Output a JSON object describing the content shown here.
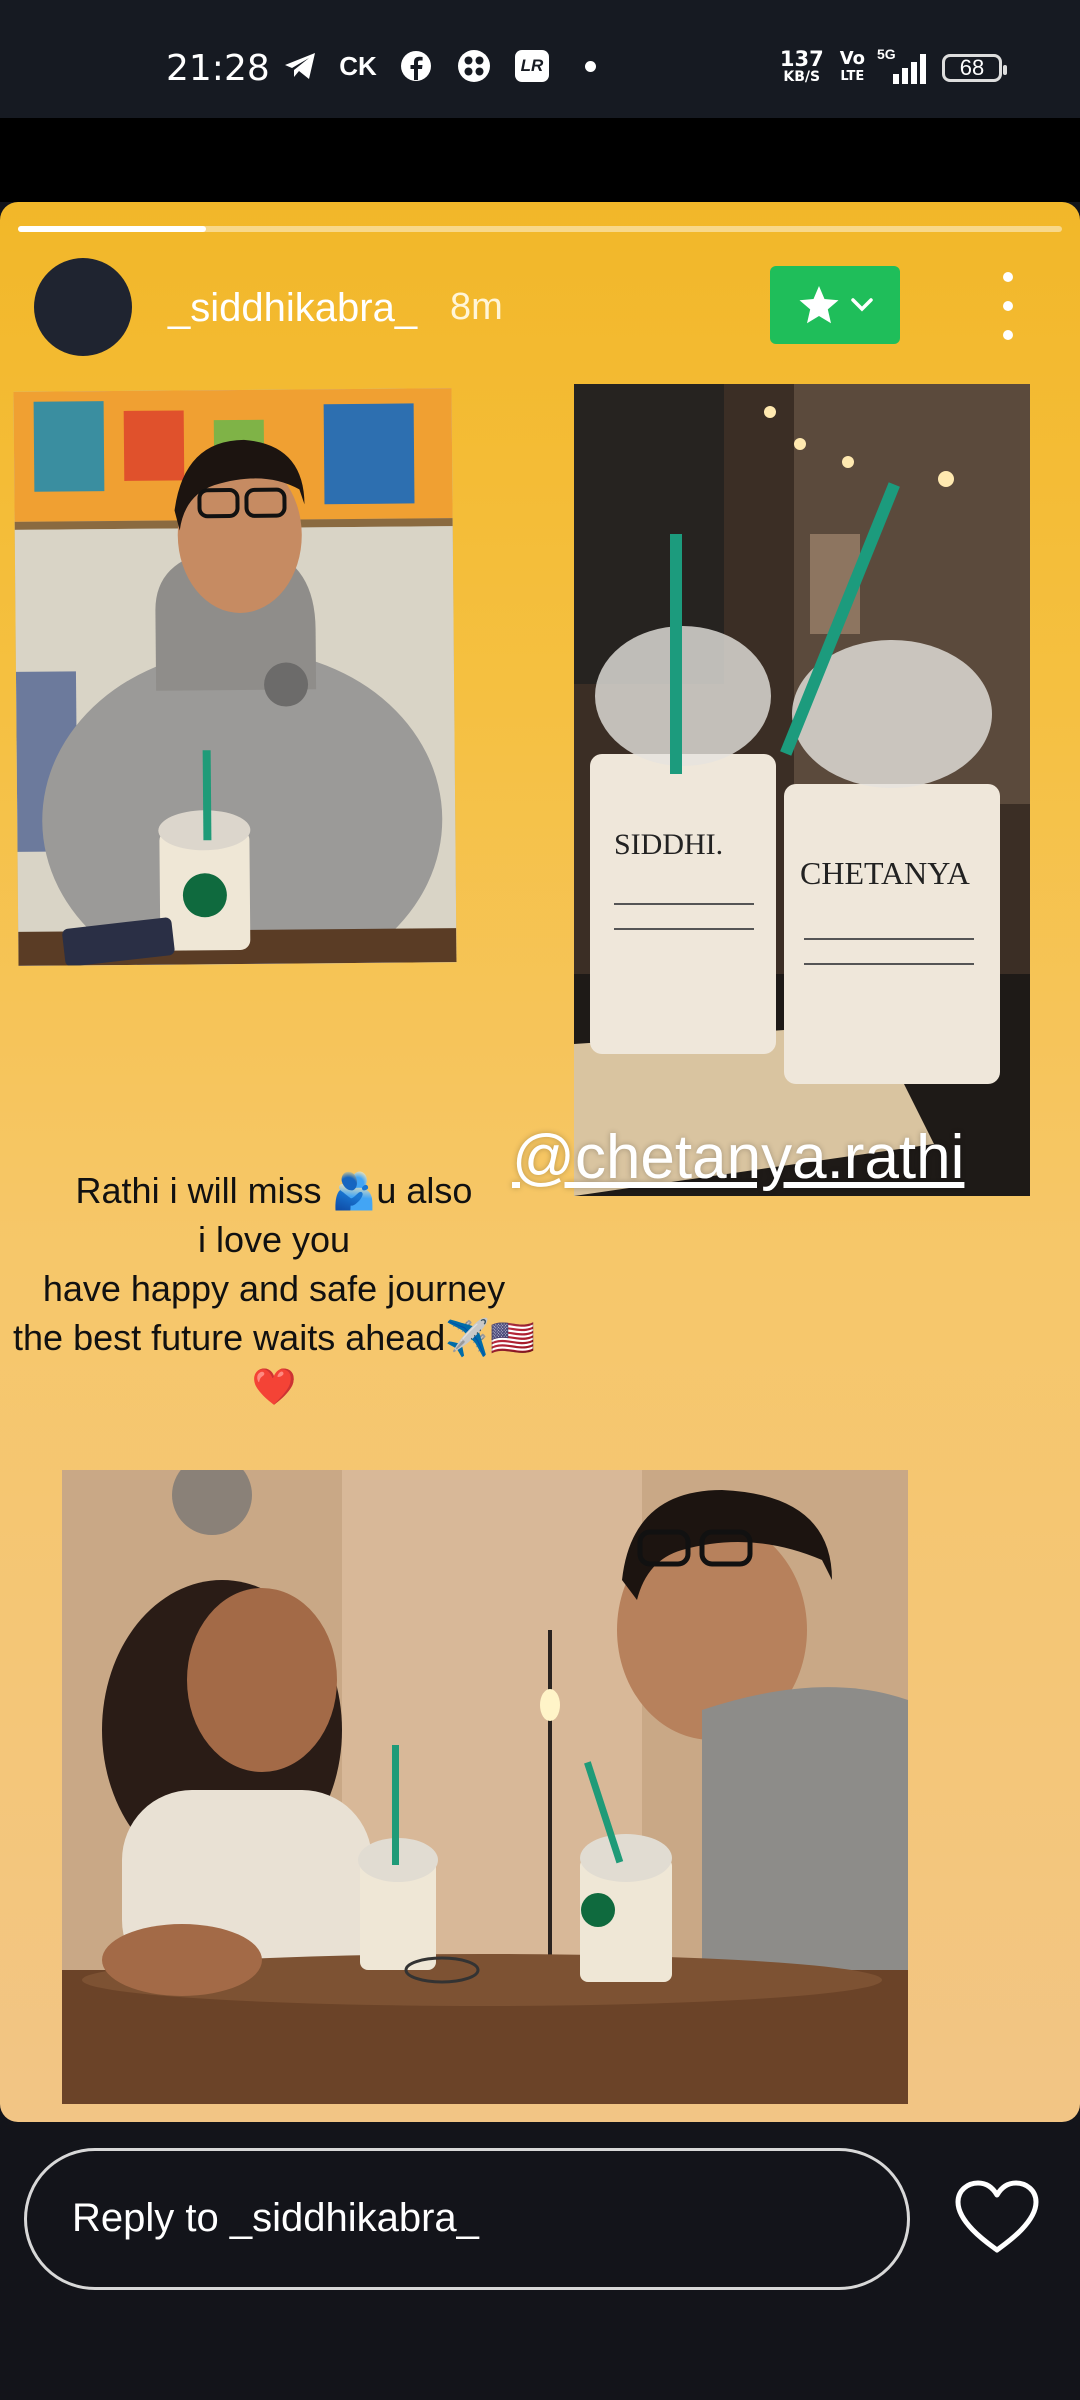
{
  "status_bar": {
    "time": "21:28",
    "icons": [
      "telegram-icon",
      "ck-icon",
      "facebook-icon",
      "grid-app-icon",
      "lightroom-icon",
      "dot-icon"
    ],
    "ck_label": "CK",
    "lr_label": "LR",
    "net_speed_value": "137",
    "net_speed_unit": "KB/S",
    "volte_top": "Vo",
    "volte_bottom": "LTE",
    "network": "5G",
    "battery": "68"
  },
  "story": {
    "progress": 0.18,
    "username": "_siddhikabra_",
    "time_ago": "8m",
    "mention": "@chetanya.rathi",
    "caption_lines": [
      "Rathi i will miss 🫂u also",
      "i love you",
      "have happy and safe journey",
      "the best future waits ahead✈️🇺🇸",
      "❤️"
    ]
  },
  "reply": {
    "placeholder": "Reply to _siddhikabra_"
  },
  "colors": {
    "story_top": "#f2b729",
    "story_bottom": "#f2c585",
    "favorite_green": "#1fbe5a"
  }
}
